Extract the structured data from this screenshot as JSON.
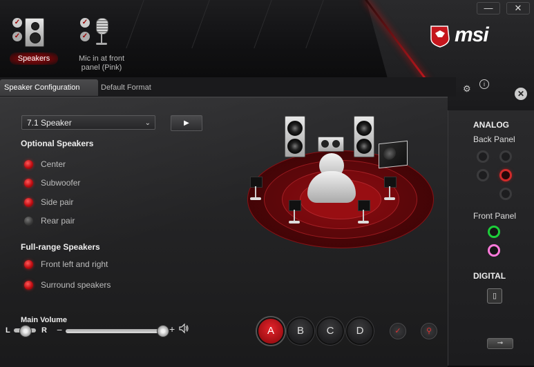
{
  "window": {
    "minimize_icon": "minimize-icon",
    "close_icon": "close-icon",
    "minimize_glyph": "—",
    "close_glyph": "✕"
  },
  "brand": {
    "name": "msi",
    "accent": "#c5161d"
  },
  "devices": [
    {
      "label": "Speakers",
      "icon": "speaker-device-icon",
      "selected": true
    },
    {
      "label": "Mic in at front panel (Pink)",
      "icon": "microphone-device-icon",
      "selected": false
    }
  ],
  "header_icons": {
    "settings": "gear-icon",
    "info": "info-icon",
    "tools": "tools-icon"
  },
  "tabs": [
    {
      "label": "Speaker Configuration",
      "active": true
    },
    {
      "label": "Default Format",
      "active": false
    }
  ],
  "speaker_config": {
    "selected": "7.1 Speaker",
    "play_icon": "play-icon",
    "play_glyph": "▶",
    "dropdown_glyph": "⌄"
  },
  "optional_speakers": {
    "title": "Optional Speakers",
    "items": [
      {
        "label": "Center",
        "on": true
      },
      {
        "label": "Subwoofer",
        "on": true
      },
      {
        "label": "Side pair",
        "on": true
      },
      {
        "label": "Rear pair",
        "on": false
      }
    ]
  },
  "fullrange_speakers": {
    "title": "Full-range Speakers",
    "items": [
      {
        "label": "Front left and right",
        "on": true
      },
      {
        "label": "Surround speakers",
        "on": true
      }
    ]
  },
  "volume": {
    "title": "Main Volume",
    "left": "L",
    "right": "R",
    "minus": "−",
    "plus": "+",
    "level": 1.0,
    "balance": 0.5,
    "speaker_icon": "speaker-volume-icon"
  },
  "profiles": [
    "A",
    "B",
    "C",
    "D"
  ],
  "profile_selected": "A",
  "right_panel": {
    "analog": "ANALOG",
    "back_panel": "Back Panel",
    "front_panel": "Front Panel",
    "digital": "DIGITAL"
  }
}
